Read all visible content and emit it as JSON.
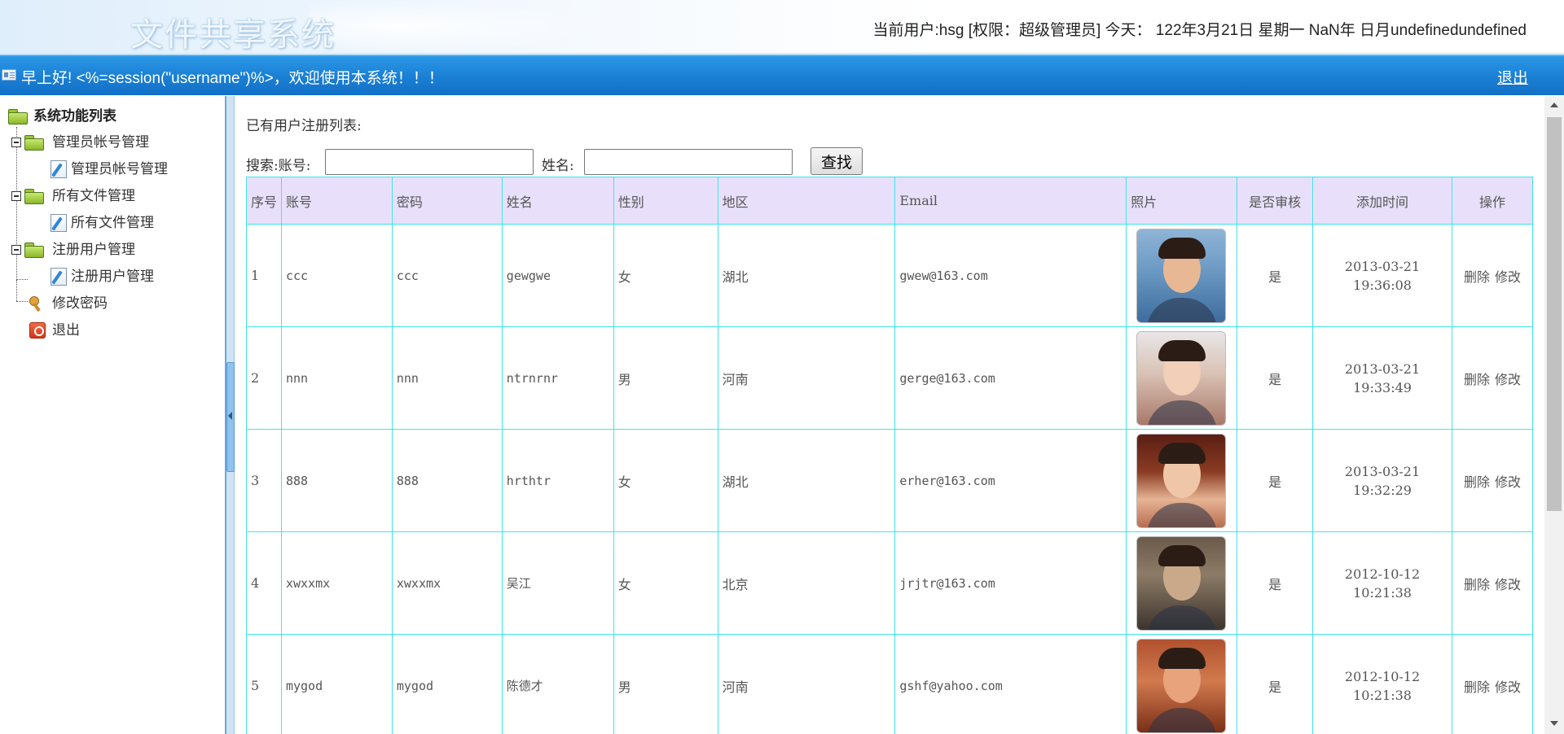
{
  "header": {
    "logo_text": "文件共享系统",
    "user_info": "当前用户:hsg [权限：超级管理员] 今天： 122年3月21日 星期一 NaN年 日月undefinedundefined"
  },
  "welcome_bar": {
    "text": "早上好! <%=session(\"username\")%>，欢迎使用本系统！！！",
    "logout_label": "退出"
  },
  "sidebar": {
    "root_label": "系统功能列表",
    "groups": [
      {
        "label": "管理员帐号管理",
        "child": "管理员帐号管理"
      },
      {
        "label": "所有文件管理",
        "child": "所有文件管理"
      },
      {
        "label": "注册用户管理",
        "child": "注册用户管理"
      }
    ],
    "change_password": "修改密码",
    "exit": "退出"
  },
  "main": {
    "title": "已有用户注册列表:",
    "search": {
      "account_label": "搜索:账号:",
      "account_value": "",
      "name_label": "姓名:",
      "name_value": "",
      "button_label": "查找"
    },
    "table": {
      "headers": [
        "序号",
        "账号",
        "密码",
        "姓名",
        "性别",
        "地区",
        "Email",
        "照片",
        "是否审核",
        "添加时间",
        "操作"
      ],
      "rows": [
        {
          "no": "1",
          "account": "ccc",
          "password": "ccc",
          "name": "gewgwe",
          "gender": "女",
          "region": "湖北",
          "email": "gwew@163.com",
          "reviewed": "是",
          "date": "2013-03-21",
          "time": "19:36:08",
          "delete": "删除",
          "edit": "修改"
        },
        {
          "no": "2",
          "account": "nnn",
          "password": "nnn",
          "name": "ntrnrnr",
          "gender": "男",
          "region": "河南",
          "email": "gerge@163.com",
          "reviewed": "是",
          "date": "2013-03-21",
          "time": "19:33:49",
          "delete": "删除",
          "edit": "修改"
        },
        {
          "no": "3",
          "account": "888",
          "password": "888",
          "name": "hrthtr",
          "gender": "女",
          "region": "湖北",
          "email": "erher@163.com",
          "reviewed": "是",
          "date": "2013-03-21",
          "time": "19:32:29",
          "delete": "删除",
          "edit": "修改"
        },
        {
          "no": "4",
          "account": "xwxxmx",
          "password": "xwxxmx",
          "name": "吴江",
          "gender": "女",
          "region": "北京",
          "email": "jrjtr@163.com",
          "reviewed": "是",
          "date": "2012-10-12",
          "time": "10:21:38",
          "delete": "删除",
          "edit": "修改"
        },
        {
          "no": "5",
          "account": "mygod",
          "password": "mygod",
          "name": "陈德才",
          "gender": "男",
          "region": "河南",
          "email": "gshf@yahoo.com",
          "reviewed": "是",
          "date": "2012-10-12",
          "time": "10:21:38",
          "delete": "删除",
          "edit": "修改"
        }
      ]
    }
  },
  "colors": {
    "welcome_bar": "#1a7fd4",
    "table_header_bg": "#e8e0fa",
    "table_border": "#3fe4ee"
  }
}
